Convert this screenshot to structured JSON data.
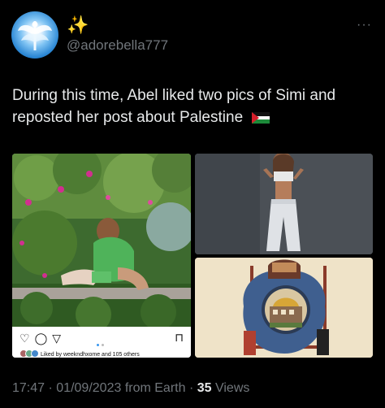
{
  "author": {
    "display_name": "✨",
    "handle": "@adorebella777",
    "avatar_icon": "angel-wings-avatar-icon"
  },
  "more_icon": "···",
  "tweet": {
    "text": "During this time, Abel liked two pics of Simi and reposted her post about Palestine",
    "flag_icon": "palestine-flag-icon"
  },
  "media": {
    "left_card": {
      "icons": [
        "heart-icon",
        "comment-icon",
        "send-icon"
      ],
      "icon_glyphs": [
        "♡",
        "◯",
        "▽"
      ],
      "save_glyph": "⊓",
      "liked_text": "Liked by weekndhxome and 105 others"
    }
  },
  "footer": {
    "time": "17:47",
    "date": "01/09/2023",
    "source": "from Earth",
    "views_count": "35",
    "views_label": "Views"
  },
  "colors": {
    "background": "#000000",
    "text": "#e7e9ea",
    "muted": "#71767b",
    "name_emoji": "#f6d36b"
  }
}
